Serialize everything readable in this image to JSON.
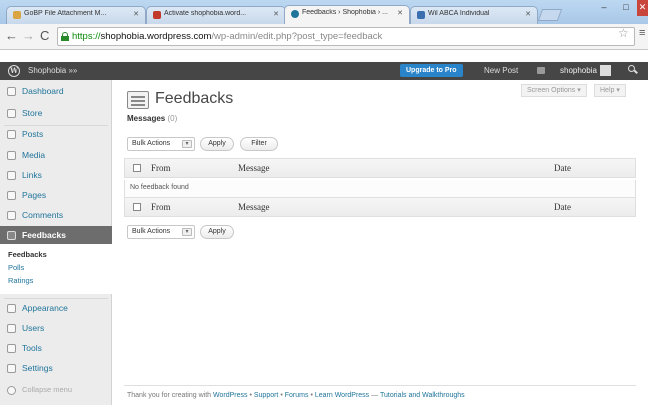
{
  "browser": {
    "tabs": [
      {
        "title": "GoBP File Attachment M...",
        "favicon_color": "#d9a441"
      },
      {
        "title": "Activate shophobia.word...",
        "favicon_color": "#c0392b"
      },
      {
        "title": "Feedbacks › Shophobia › ...",
        "favicon_color": "#21759b"
      },
      {
        "title": "Wil ABCA Individual",
        "favicon_color": "#3a6fb0"
      }
    ],
    "url_scheme": "https://",
    "url_host": "shophobia.wordpress.com",
    "url_path": "/wp-admin/edit.php?post_type=feedback"
  },
  "adminbar": {
    "site_name": "Shophobia »»",
    "upgrade_label": "Upgrade to Pro",
    "new_post_label": "New Post",
    "user_name": "shophobia"
  },
  "sidebar": {
    "items": [
      {
        "label": "Dashboard"
      },
      {
        "label": "Store"
      },
      {
        "label": "Posts"
      },
      {
        "label": "Media"
      },
      {
        "label": "Links"
      },
      {
        "label": "Pages"
      },
      {
        "label": "Comments"
      },
      {
        "label": "Feedbacks"
      },
      {
        "label": "Appearance"
      },
      {
        "label": "Users"
      },
      {
        "label": "Tools"
      },
      {
        "label": "Settings"
      }
    ],
    "submenu": [
      "Feedbacks",
      "Polls",
      "Ratings"
    ],
    "collapse_label": "Collapse menu"
  },
  "main": {
    "title": "Feedbacks",
    "screen_options": "Screen Options ▾",
    "help": "Help ▾",
    "messages_label": "Messages",
    "messages_count": "(0)",
    "bulk_actions": "Bulk Actions",
    "apply": "Apply",
    "filter": "Filter",
    "columns": {
      "from": "From",
      "message": "Message",
      "date": "Date"
    },
    "empty_message": "No feedback found"
  },
  "footer": {
    "prefix": "Thank you for creating with",
    "wp": "WordPress",
    "sep1": "•",
    "support": "Support",
    "sep2": "•",
    "forums": "Forums",
    "sep3": "•",
    "learn": "Learn WordPress",
    "dash": "—",
    "tutorials": "Tutorials and Walkthroughs"
  }
}
